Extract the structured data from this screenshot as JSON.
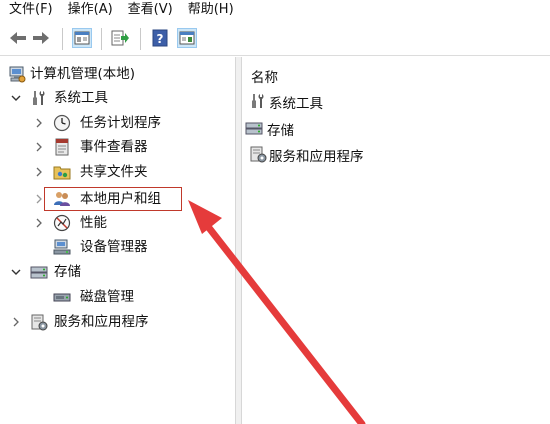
{
  "menubar": {
    "items": [
      "文件(F)",
      "操作(A)",
      "查看(V)",
      "帮助(H)"
    ]
  },
  "toolbar": {
    "buttons": [
      "back-icon",
      "forward-icon",
      "show-hide-tree-icon",
      "export-list-icon",
      "help-icon",
      "show-hide-action-pane-icon"
    ]
  },
  "tree": {
    "root": "计算机管理(本地)",
    "system_tools": "系统工具",
    "task_scheduler": "任务计划程序",
    "event_viewer": "事件查看器",
    "shared_folders": "共享文件夹",
    "local_users": "本地用户和组",
    "performance": "性能",
    "device_manager": "设备管理器",
    "storage": "存储",
    "disk_management": "磁盘管理",
    "services_apps": "服务和应用程序"
  },
  "list": {
    "column_name": "名称",
    "items": [
      "系统工具",
      "存储",
      "服务和应用程序"
    ]
  },
  "colors": {
    "highlight": "#c0392b",
    "arrow": "#e53b3b"
  }
}
